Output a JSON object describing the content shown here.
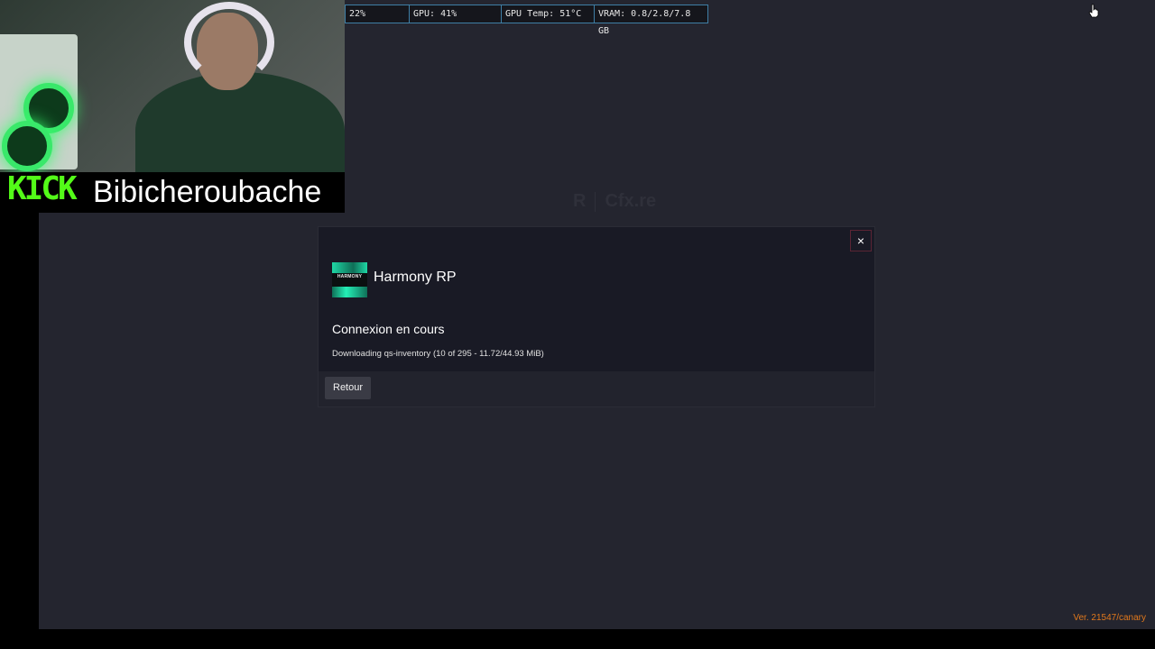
{
  "stats_overlay": {
    "cpu": "22%",
    "gpu": "GPU: 41%",
    "gpu_temp": "GPU Temp: 51°C",
    "vram": "VRAM: 0.8/2.8/7.8 GB"
  },
  "stream_overlay": {
    "platform_logo": "KICK",
    "streamer_name": "Bibicheroubache"
  },
  "background": {
    "logo_text": "Cfx.re"
  },
  "modal": {
    "server_name": "Harmony RP",
    "server_logo_text": "HARMONY",
    "status_title": "Connexion en cours",
    "status_detail": "Downloading qs-inventory (10 of 295 - 11.72/44.93 MiB)",
    "progress": {
      "files_done": 10,
      "files_total": 295,
      "mib_done": 11.72,
      "mib_total": 44.93
    },
    "close_label": "×",
    "back_button_label": "Retour"
  },
  "version": "Ver. 21547/canary",
  "colors": {
    "background": "#24252f",
    "modal": "#191a25",
    "kick_green": "#53fc18",
    "version_orange": "#e0781c",
    "stat_border": "#3f7fa6"
  },
  "icons": {
    "close": "close-icon",
    "cursor": "hand-cursor-icon"
  }
}
